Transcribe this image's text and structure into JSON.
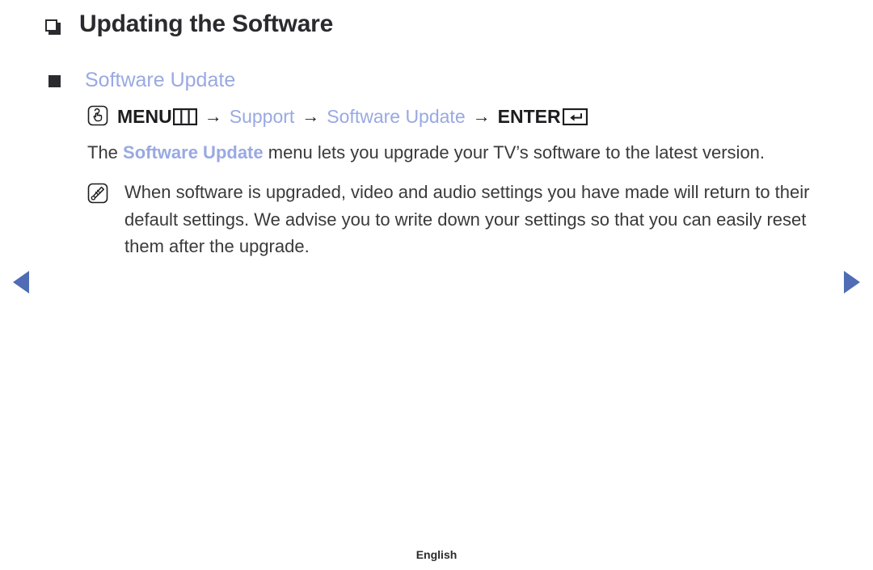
{
  "page": {
    "title": "Updating the Software",
    "title_bullet_icon": "hollow-square-shadow-icon",
    "subheading": "Software Update",
    "subheading_bullet_icon": "filled-square-icon",
    "footer_language": "English",
    "accent_blue": "#99a9e2",
    "text_color": "#3a3a3c",
    "heading_color": "#2b2a2e",
    "nav_arrow_color": "#4f6cb5"
  },
  "nav": {
    "prev_label": "previous-page-arrow",
    "next_label": "next-page-arrow"
  },
  "menu_path": {
    "pointer_icon": "hand-pointer-icon",
    "menu_label": "MENU",
    "menu_icon": "menu-three-pane-icon",
    "arrow1": "→",
    "support_label": "Support",
    "arrow2": "→",
    "software_update_label": "Software Update",
    "arrow3": "→",
    "enter_label": "ENTER",
    "enter_icon": "enter-return-icon"
  },
  "body": {
    "paragraph_pre": "The ",
    "paragraph_highlight": "Software Update",
    "paragraph_post": " menu lets you upgrade your TV’s software to the latest version."
  },
  "note": {
    "icon": "note-pencil-icon",
    "text": "When software is upgraded, video and audio settings you have made will return to their default settings. We advise you to write down your settings so that you can easily reset them after the upgrade."
  }
}
